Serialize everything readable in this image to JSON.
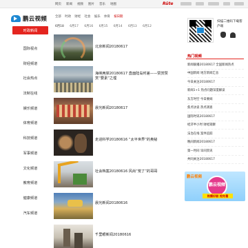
{
  "topbar": {
    "links": [
      "网页",
      "新闻",
      "视频",
      "图片",
      "音乐",
      "地图"
    ],
    "brand": "Rüte"
  },
  "logo": {
    "text": "鹏云视频"
  },
  "sidebar": {
    "items": [
      "时政新闻",
      "国际视点",
      "财经频道",
      "社会热点",
      "法制在线",
      "娱乐频道",
      "体育频道",
      "科技频道",
      "军事频道",
      "文化频道",
      "教育频道",
      "健康频道",
      "汽车频道"
    ]
  },
  "filters": {
    "items": [
      "全部",
      "时政",
      "财经",
      "社会",
      "娱乐",
      "体育"
    ],
    "date_label": "按日期"
  },
  "dates": [
    "6月18",
    "6月17",
    "6月16",
    "6月15",
    "6月14",
    "6月13",
    "6月12"
  ],
  "videos": [
    {
      "title": "北京新闻20180617"
    },
    {
      "title": "海峡两岸20180617 直面陆岛时差——赞赏赞赏“要素”之理"
    },
    {
      "title": "晨光新闻20180617"
    },
    {
      "title": "走进科学20180616 “太平世界”的奥秘"
    },
    {
      "title": "社会档案20180616 风尚“荒了”的哥哥"
    },
    {
      "title": "晨光新闻20180616"
    },
    {
      "title": "千里眼新闻20180616"
    }
  ],
  "qr": {
    "text": "扫描二维码下载客户端"
  },
  "hot": {
    "title": "热门视频",
    "items": [
      "新闻联播20180617 全国新闻热点",
      "中国新闻 地方新闻汇总",
      "今日关注20180617",
      "新闻1+1 热点问题深度解读",
      "东方时空 今日要闻",
      "焦点访谈 热点调查",
      "国际时讯20180617",
      "经济半小时 财经观察",
      "法治在线 案件追踪",
      "晚间新闻20180617",
      "第一时间 早间资讯",
      "共同关注20180617"
    ]
  },
  "banner": {
    "slogan": "鹏云视频",
    "badge": "鹏云视频",
    "strip": "热播好剧 抢先看"
  },
  "colors": {
    "accent": "#e4251f",
    "brand_blue": "#1e88d2"
  }
}
